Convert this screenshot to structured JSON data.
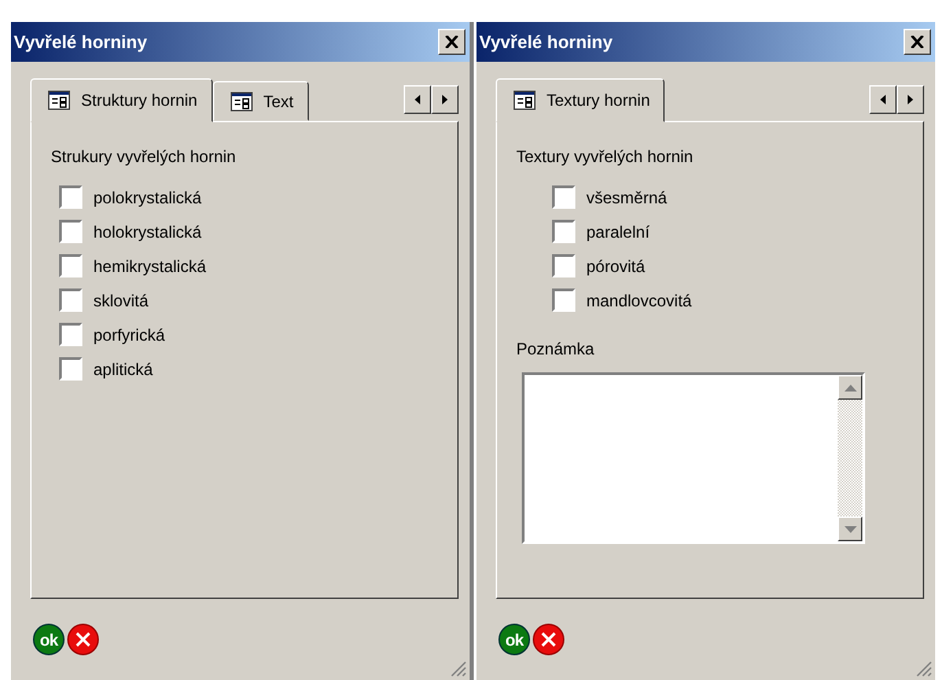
{
  "windows": [
    {
      "title": "Vyvřelé horniny",
      "tabs": [
        {
          "label": "Struktury hornin",
          "selected": true
        },
        {
          "label": "Text",
          "selected": false
        }
      ],
      "section_title": "Strukury vyvřelých hornin",
      "options": [
        {
          "label": "polokrystalická",
          "checked": false
        },
        {
          "label": "holokrystalická",
          "checked": false
        },
        {
          "label": "hemikrystalická",
          "checked": false
        },
        {
          "label": "sklovitá",
          "checked": false
        },
        {
          "label": "porfyrická",
          "checked": false
        },
        {
          "label": "aplitická",
          "checked": false
        }
      ],
      "ok_label": "ok"
    },
    {
      "title": "Vyvřelé horniny",
      "tabs": [
        {
          "label": "Textury hornin",
          "selected": true
        }
      ],
      "section_title": "Textury vyvřelých hornin",
      "options": [
        {
          "label": "všesměrná",
          "checked": false
        },
        {
          "label": "paralelní",
          "checked": false
        },
        {
          "label": "pórovitá",
          "checked": false
        },
        {
          "label": "mandlovcovitá",
          "checked": false
        }
      ],
      "note": {
        "label": "Poznámka"
      },
      "ok_label": "ok"
    }
  ]
}
